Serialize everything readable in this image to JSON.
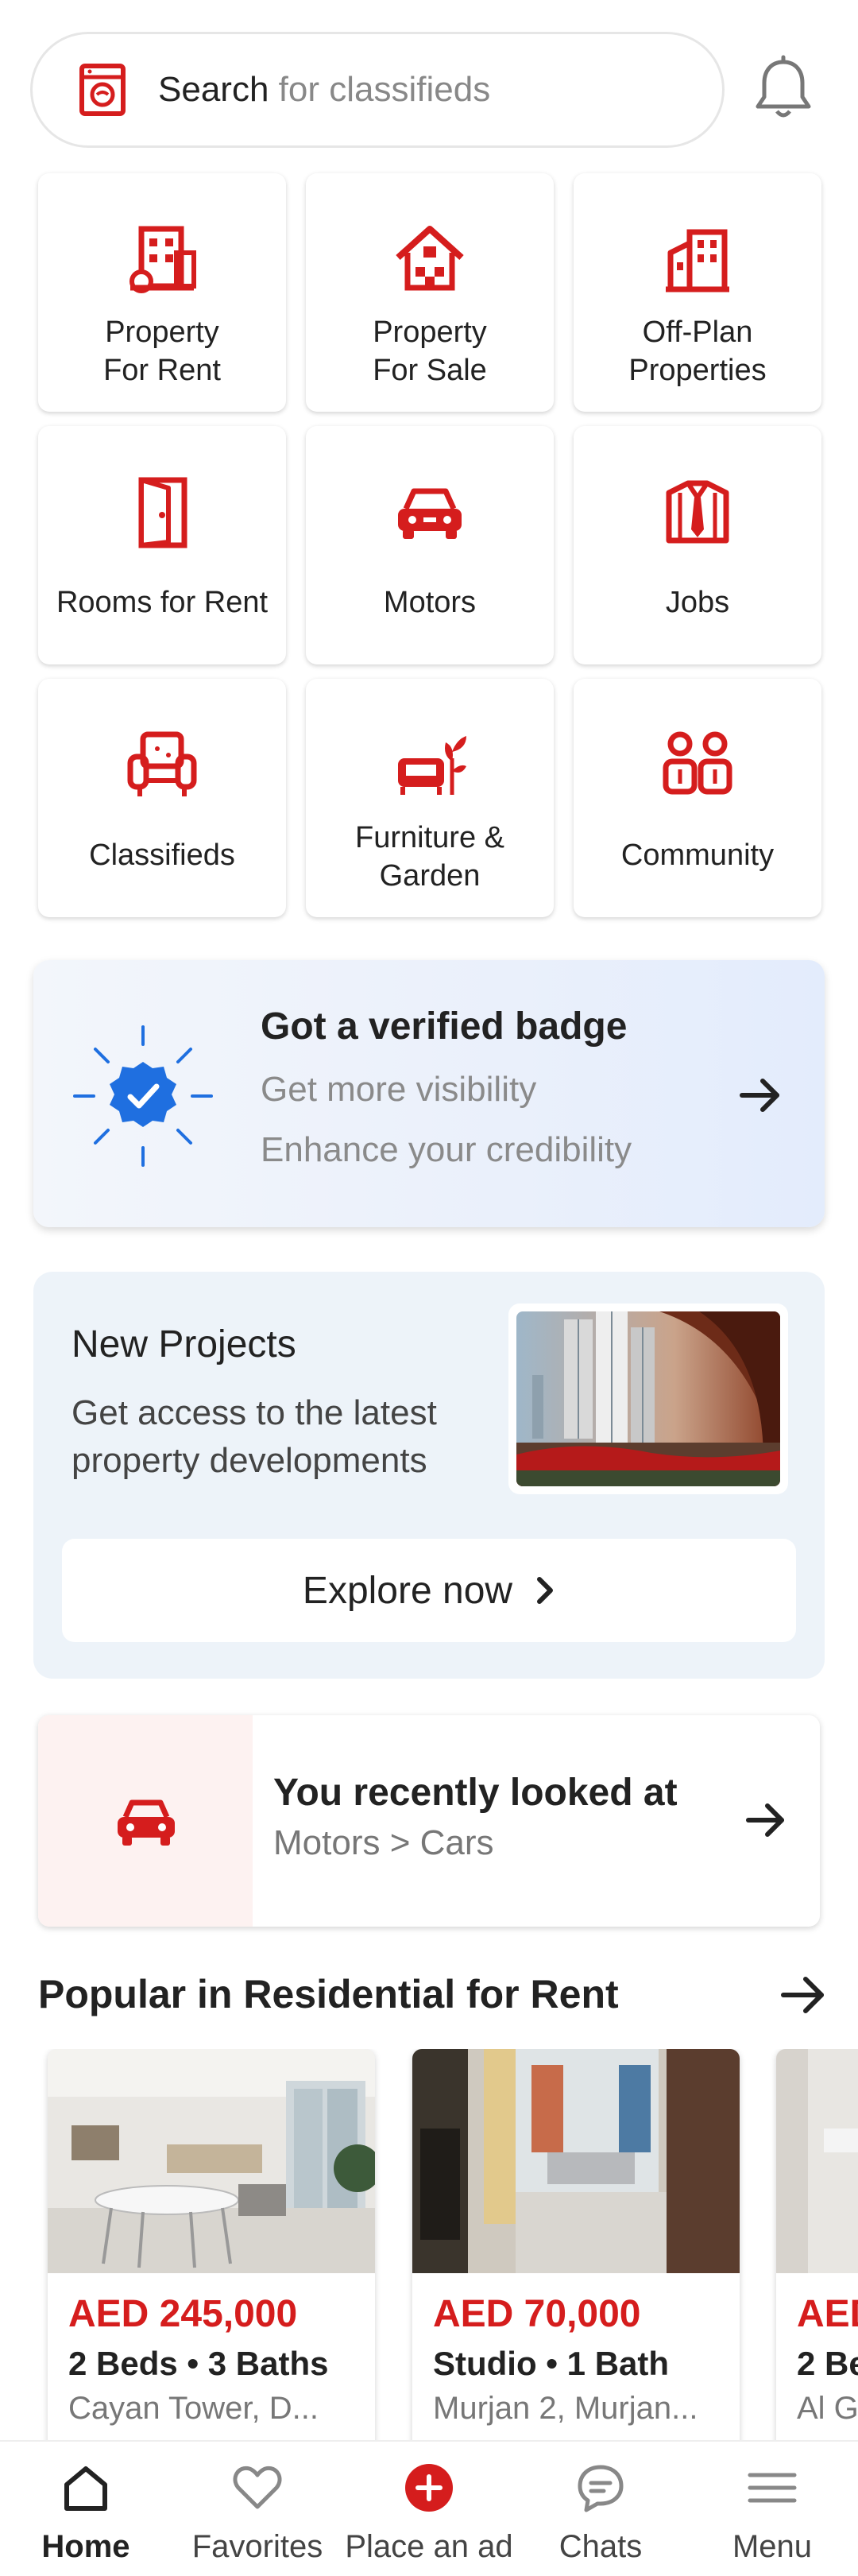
{
  "search": {
    "label": "Search",
    "placeholder": "for classifieds"
  },
  "categories": [
    {
      "label_line1": "Property",
      "label_line2": "For Rent",
      "icon": "building-icon"
    },
    {
      "label_line1": "Property",
      "label_line2": "For Sale",
      "icon": "house-icon"
    },
    {
      "label_line1": "Off-Plan",
      "label_line2": "Properties",
      "icon": "tower-icon"
    },
    {
      "label_line1": "Rooms for Rent",
      "label_line2": "",
      "icon": "door-icon"
    },
    {
      "label_line1": "Motors",
      "label_line2": "",
      "icon": "car-icon"
    },
    {
      "label_line1": "Jobs",
      "label_line2": "",
      "icon": "shirt-tie-icon"
    },
    {
      "label_line1": "Classifieds",
      "label_line2": "",
      "icon": "armchair-icon"
    },
    {
      "label_line1": "Furniture &",
      "label_line2": "Garden",
      "icon": "sofa-plant-icon"
    },
    {
      "label_line1": "Community",
      "label_line2": "",
      "icon": "people-icon"
    }
  ],
  "verified": {
    "title": "Got a verified badge",
    "line1": "Get more visibility",
    "line2": "Enhance your credibility"
  },
  "new_projects": {
    "title": "New Projects",
    "description": "Get access to the latest property developments",
    "cta": "Explore now"
  },
  "recent": {
    "title": "You recently looked at",
    "path": "Motors > Cars"
  },
  "popular": {
    "heading": "Popular in Residential for Rent",
    "listings": [
      {
        "price": "AED 245,000",
        "details": "2 Beds • 3 Baths",
        "location": "Cayan Tower, D..."
      },
      {
        "price": "AED 70,000",
        "details": "Studio • 1 Bath",
        "location": "Murjan 2, Murjan..."
      },
      {
        "price": "AED",
        "details": "2 Be",
        "location": "Al G"
      }
    ]
  },
  "nav": {
    "home": "Home",
    "favorites": "Favorites",
    "place_ad": "Place an ad",
    "chats": "Chats",
    "menu": "Menu"
  },
  "colors": {
    "brand_red": "#d51d1d",
    "verified_blue": "#1f6fe0"
  }
}
